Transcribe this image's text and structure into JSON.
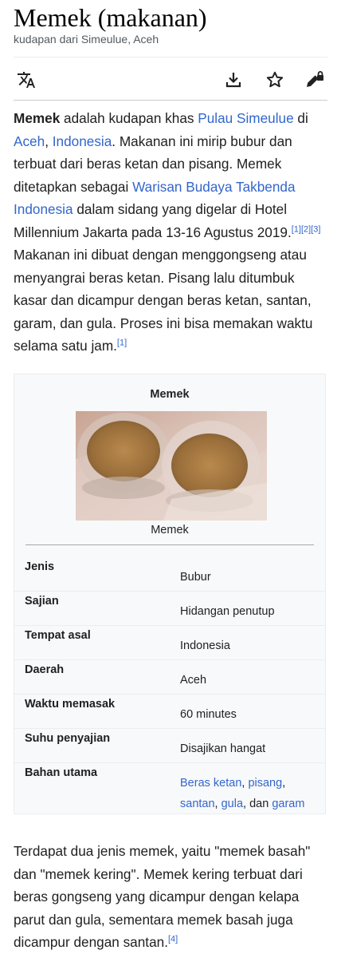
{
  "page": {
    "title": "Memek (makanan)",
    "subtitle": "kudapan dari Simeulue, Aceh"
  },
  "toolbar": {
    "language_icon": "translate-icon",
    "download_icon": "download-icon",
    "star_icon": "star-icon",
    "edit_icon": "edit-locked-icon"
  },
  "intro": {
    "p1": "Memek",
    "p2": " adalah kudapan khas ",
    "link1": "Pulau Simeulue",
    "p3": " di ",
    "link2": "Aceh",
    "p4": ", ",
    "link3": "Indonesia",
    "p5": ". Makanan ini mirip bubur dan terbuat dari beras ketan dan pisang. Memek ditetapkan sebagai ",
    "link4": "Warisan Budaya Takbenda Indonesia",
    "p6": " dalam sidang yang digelar di Hotel Millennium Jakarta pada 13-16 Agustus 2019.",
    "ref1": "[1]",
    "ref2": "[2]",
    "ref3": "[3]",
    "p7": " Makanan ini dibuat dengan menggongseng atau menyangrai beras ketan. Pisang lalu ditumbuk kasar dan dicampur dengan beras ketan, santan, garam, dan gula. Proses ini bisa memakan waktu selama satu jam.",
    "ref4": "[1]"
  },
  "infobox": {
    "title": "Memek",
    "caption": "Memek",
    "rows": [
      {
        "label": "Jenis",
        "value": "Bubur"
      },
      {
        "label": "Sajian",
        "value": "Hidangan penutup"
      },
      {
        "label": "Tempat asal",
        "value": "Indonesia"
      },
      {
        "label": "Daerah",
        "value": "Aceh"
      },
      {
        "label": "Waktu memasak",
        "value": "60 minutes"
      },
      {
        "label": "Suhu penyajian",
        "value": "Disajikan hangat"
      },
      {
        "label": "Bahan utama",
        "links": [
          "Beras ketan",
          "pisang",
          "santan",
          "gula",
          "garam"
        ],
        "sep1": ", ",
        "sep2": ", dan "
      }
    ]
  },
  "body2": {
    "text": "Terdapat dua jenis memek, yaitu \"memek basah\" dan \"memek kering\". Memek kering terbuat dari beras gongseng yang dicampur dengan kelapa parut dan gula, sementara memek basah juga dicampur dengan santan.",
    "ref": "[4]"
  },
  "colors": {
    "link": "#3366cc",
    "text": "#202122",
    "infobox_bg": "#f8f9fa"
  }
}
